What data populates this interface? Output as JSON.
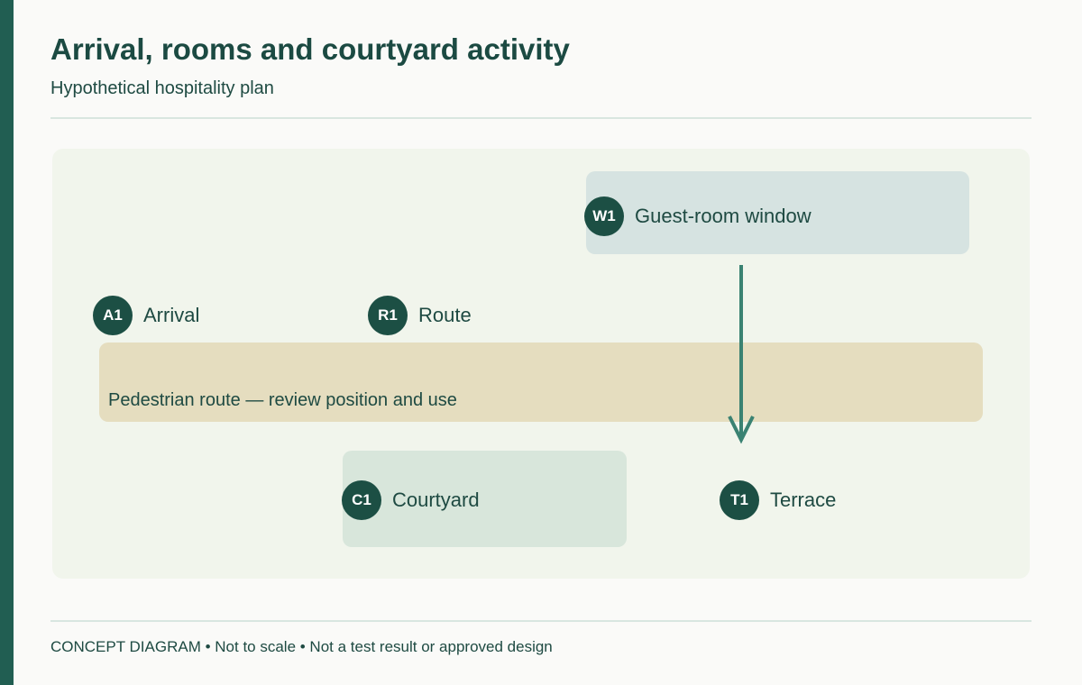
{
  "header": {
    "title": "Arrival, rooms and courtyard activity",
    "subtitle": "Hypothetical hospitality plan"
  },
  "diagram": {
    "route_zone_caption": "Pedestrian route — review position and use",
    "markers": {
      "window": {
        "code": "W1",
        "label": "Guest-room window"
      },
      "arrival": {
        "code": "A1",
        "label": "Arrival"
      },
      "route": {
        "code": "R1",
        "label": "Route"
      },
      "courtyard": {
        "code": "C1",
        "label": "Courtyard"
      },
      "terrace": {
        "code": "T1",
        "label": "Terrace"
      }
    },
    "colors": {
      "accent": "#215e52",
      "marker": "#1c4f44",
      "arrow": "#3a8272",
      "window_zone": "#d6e3e1",
      "route_zone": "#e5ddbf",
      "courtyard_zone": "#d8e6db",
      "panel": "#f1f5ec"
    }
  },
  "footer": {
    "note": "CONCEPT DIAGRAM • Not to scale • Not a test result or approved design"
  }
}
